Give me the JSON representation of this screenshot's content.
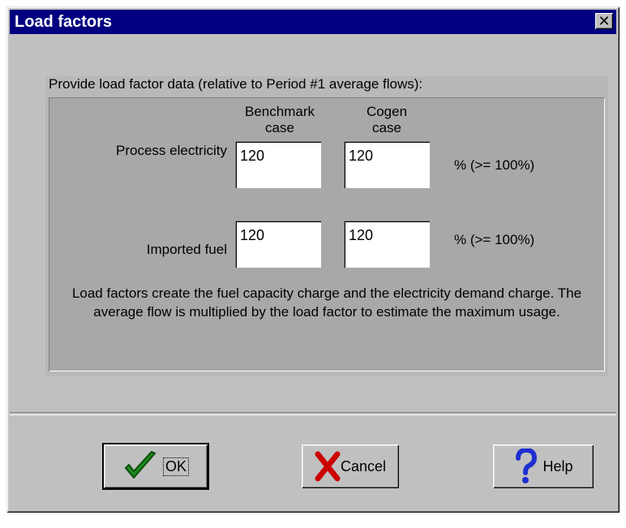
{
  "window": {
    "title": "Load factors",
    "close_glyph": "✕"
  },
  "panel": {
    "label": "Provide load factor data (relative to Period #1 average flows):"
  },
  "columns": {
    "benchmark": "Benchmark\ncase",
    "cogen": "Cogen\ncase"
  },
  "rows": [
    {
      "label": "Process electricity",
      "benchmark": "120",
      "cogen": "120",
      "unit": "% (>= 100%)"
    },
    {
      "label": "Imported fuel",
      "benchmark": "120",
      "cogen": "120",
      "unit": "% (>= 100%)"
    }
  ],
  "note": "Load factors create the fuel capacity charge and the electricity demand charge.  The average flow is multiplied by the load factor to estimate the maximum usage.",
  "buttons": {
    "ok": {
      "label": "OK",
      "icon": "check-icon"
    },
    "cancel": {
      "label": "Cancel",
      "icon": "x-icon"
    },
    "help": {
      "label": "Help",
      "icon": "question-icon"
    }
  },
  "colors": {
    "titlebar": "#000080",
    "check": "#1f8a1f",
    "cancel": "#cc0000",
    "help": "#1e2fd0"
  }
}
